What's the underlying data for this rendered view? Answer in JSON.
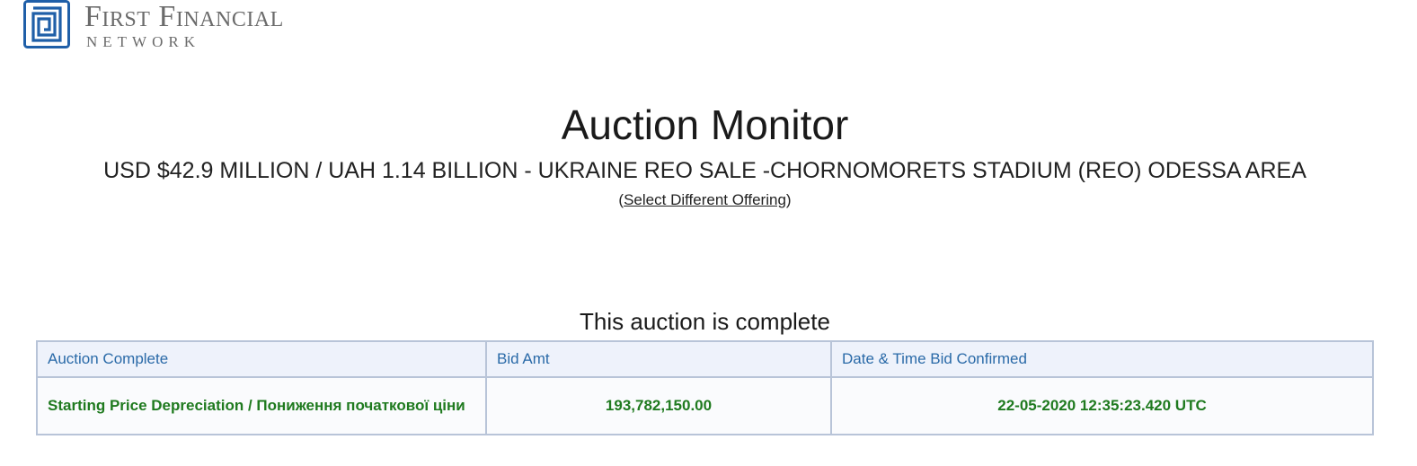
{
  "logo": {
    "line1": "First Financial",
    "line2": "NETWORK",
    "icon": "ffn-logo-mark",
    "color": "#1f5fa8"
  },
  "page": {
    "title": "Auction Monitor",
    "offering": "USD $42.9 MILLION / UAH 1.14 BILLION - UKRAINE REO SALE -CHORNOMORETS STADIUM (REO) ODESSA AREA",
    "select_prefix": "(",
    "select_link": "Select Different Offering",
    "select_suffix": ")",
    "status": "This auction is complete"
  },
  "table": {
    "headers": [
      "Auction Complete",
      "Bid Amt",
      "Date & Time Bid Confirmed"
    ],
    "rows": [
      {
        "description": "Starting Price Depreciation / Пониження початкової ціни",
        "amount": "193,782,150.00",
        "confirmed": "22-05-2020 12:35:23.420 UTC"
      }
    ]
  },
  "colors": {
    "header_text": "#2a6aa8",
    "header_bg": "#eef2fb",
    "row_text": "#1f7a1f",
    "border": "#b8c4d8"
  }
}
